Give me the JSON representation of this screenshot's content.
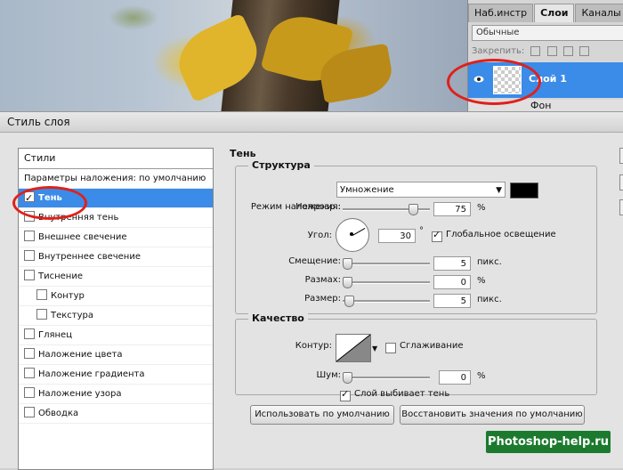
{
  "layers_panel": {
    "tabs": [
      "Наб.инстр",
      "Слои",
      "Каналы"
    ],
    "active_tab": "Слои",
    "blend_mode": "Обычные",
    "lock_label": "Закрепить:",
    "layers": [
      "Слой 1",
      "Фон"
    ]
  },
  "dialog": {
    "title": "Стиль слоя",
    "styles": {
      "header": "Стили",
      "items": [
        {
          "label": "Параметры наложения: по умолчанию",
          "checkbox": false,
          "checked": false,
          "active": false,
          "sub": false
        },
        {
          "label": "Тень",
          "checkbox": true,
          "checked": true,
          "active": true,
          "sub": false
        },
        {
          "label": "Внутренняя тень",
          "checkbox": true,
          "checked": false,
          "active": false,
          "sub": false
        },
        {
          "label": "Внешнее свечение",
          "checkbox": true,
          "checked": false,
          "active": false,
          "sub": false
        },
        {
          "label": "Внутреннее свечение",
          "checkbox": true,
          "checked": false,
          "active": false,
          "sub": false
        },
        {
          "label": "Тиснение",
          "checkbox": true,
          "checked": false,
          "active": false,
          "sub": false
        },
        {
          "label": "Контур",
          "checkbox": true,
          "checked": false,
          "active": false,
          "sub": true
        },
        {
          "label": "Текстура",
          "checkbox": true,
          "checked": false,
          "active": false,
          "sub": true
        },
        {
          "label": "Глянец",
          "checkbox": true,
          "checked": false,
          "active": false,
          "sub": false
        },
        {
          "label": "Наложение цвета",
          "checkbox": true,
          "checked": false,
          "active": false,
          "sub": false
        },
        {
          "label": "Наложение градиента",
          "checkbox": true,
          "checked": false,
          "active": false,
          "sub": false
        },
        {
          "label": "Наложение узора",
          "checkbox": true,
          "checked": false,
          "active": false,
          "sub": false
        },
        {
          "label": "Обводка",
          "checkbox": true,
          "checked": false,
          "active": false,
          "sub": false
        }
      ]
    },
    "shadow": {
      "section": "Тень",
      "structure": {
        "title": "Структура",
        "blend_label": "Режим наложения:",
        "blend_mode": "Умножение",
        "shadow_color": "#000000",
        "opacity_label": "Непрозр.:",
        "opacity": "75",
        "opacity_unit": "%",
        "angle_label": "Угол:",
        "angle": "30",
        "angle_unit": "°",
        "global_light_label": "Глобальное освещение",
        "global_light": true,
        "distance_label": "Смещение:",
        "distance": "5",
        "distance_unit": "пикс.",
        "spread_label": "Размах:",
        "spread": "0",
        "spread_unit": "%",
        "size_label": "Размер:",
        "size": "5",
        "size_unit": "пикс."
      },
      "quality": {
        "title": "Качество",
        "contour_label": "Контур:",
        "antialias_label": "Сглаживание",
        "antialias": false,
        "noise_label": "Шум:",
        "noise": "0",
        "noise_unit": "%"
      },
      "knockout_label": "Слой выбивает тень",
      "knockout": true,
      "default_button": "Использовать по умолчанию",
      "reset_button": "Восстановить значения по умолчанию"
    }
  },
  "watermark": "Photoshop-help.ru",
  "colors": {
    "highlight": "#3b8be8",
    "annotation": "#e0201a",
    "watermark_bg": "#1b7a2d"
  }
}
